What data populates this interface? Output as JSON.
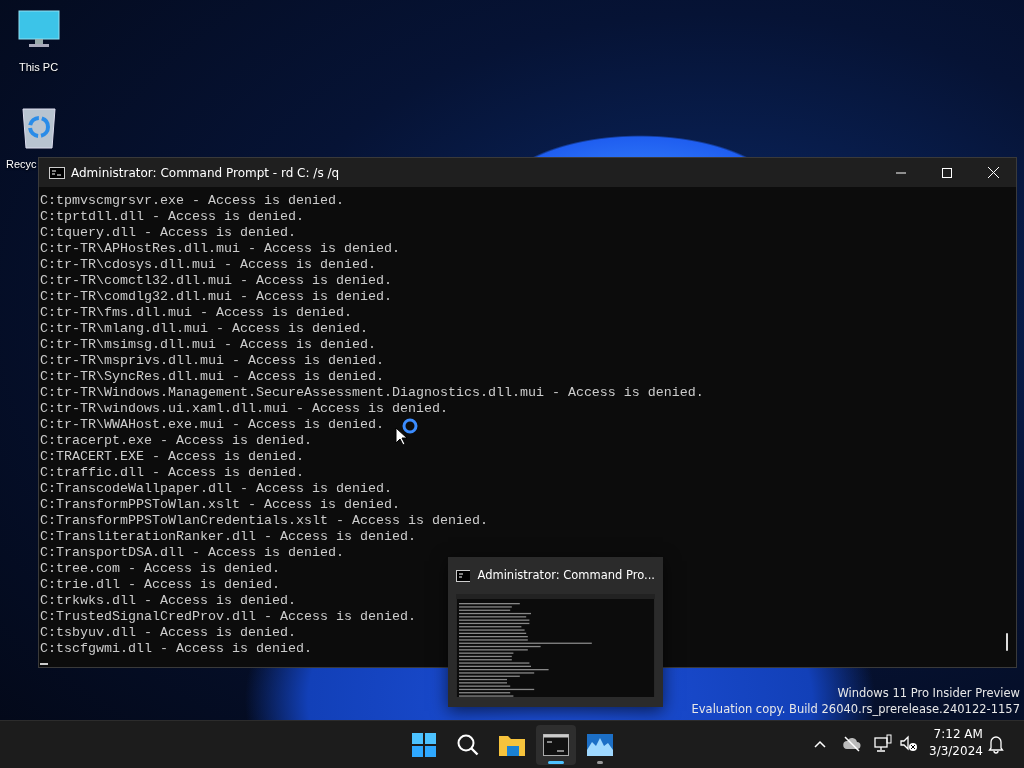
{
  "desktop_icons": [
    {
      "kind": "pc",
      "label": "This PC"
    },
    {
      "kind": "bin",
      "label": "Recyc"
    }
  ],
  "window": {
    "title": "Administrator: Command Prompt - rd  C: /s /q",
    "lines": [
      "C:tpmvscmgrsvr.exe - Access is denied.",
      "C:tprtdll.dll - Access is denied.",
      "C:tquery.dll - Access is denied.",
      "C:tr-TR\\APHostRes.dll.mui - Access is denied.",
      "C:tr-TR\\cdosys.dll.mui - Access is denied.",
      "C:tr-TR\\comctl32.dll.mui - Access is denied.",
      "C:tr-TR\\comdlg32.dll.mui - Access is denied.",
      "C:tr-TR\\fms.dll.mui - Access is denied.",
      "C:tr-TR\\mlang.dll.mui - Access is denied.",
      "C:tr-TR\\msimsg.dll.mui - Access is denied.",
      "C:tr-TR\\msprivs.dll.mui - Access is denied.",
      "C:tr-TR\\SyncRes.dll.mui - Access is denied.",
      "C:tr-TR\\Windows.Management.SecureAssessment.Diagnostics.dll.mui - Access is denied.",
      "C:tr-TR\\windows.ui.xaml.dll.mui - Access is denied.",
      "C:tr-TR\\WWAHost.exe.mui - Access is denied.",
      "C:tracerpt.exe - Access is denied.",
      "C:TRACERT.EXE - Access is denied.",
      "C:traffic.dll - Access is denied.",
      "C:TranscodeWallpaper.dll - Access is denied.",
      "C:TransformPPSToWlan.xslt - Access is denied.",
      "C:TransformPPSToWlanCredentials.xslt - Access is denied.",
      "C:TransliterationRanker.dll - Access is denied.",
      "C:TransportDSA.dll - Access is denied.",
      "C:tree.com - Access is denied.",
      "C:trie.dll - Access is denied.",
      "C:trkwks.dll - Access is denied.",
      "C:TrustedSignalCredProv.dll - Access is denied.",
      "C:tsbyuv.dll - Access is denied.",
      "C:tscfgwmi.dll - Access is denied."
    ]
  },
  "thumbnail_preview": {
    "title": "Administrator: Command Pro..."
  },
  "watermark": {
    "line_1": "Windows 11 Pro Insider Preview",
    "line_2": "Evaluation copy. Build 26040.rs_prerelease.240122-1157"
  },
  "taskbar": {
    "apps": [
      {
        "kind": "start",
        "running": false,
        "selected": false
      },
      {
        "kind": "search",
        "running": false,
        "selected": false
      },
      {
        "kind": "explorer",
        "running": false,
        "selected": false
      },
      {
        "kind": "terminal",
        "running": true,
        "selected": true
      },
      {
        "kind": "monitor",
        "running": true,
        "selected": false
      }
    ],
    "tray": {
      "time": "7:12 AM",
      "date": "3/3/2024"
    }
  }
}
